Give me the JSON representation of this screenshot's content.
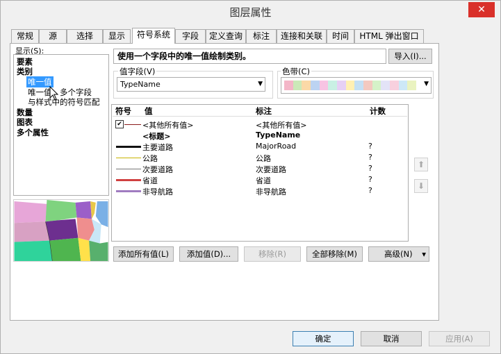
{
  "window": {
    "title": "图层属性",
    "close_glyph": "✕"
  },
  "tabs": [
    "常规",
    "源",
    "选择",
    "显示",
    "符号系统",
    "字段",
    "定义查询",
    "标注",
    "连接和关联",
    "时间",
    "HTML 弹出窗口"
  ],
  "show": {
    "label": "显示(S):",
    "items": [
      "要素",
      "类别",
      "唯一值",
      "唯一值，多个字段",
      "与样式中的符号匹配",
      "数量",
      "图表",
      "多个属性"
    ]
  },
  "description": "使用一个字段中的唯一值绘制类别。",
  "import_label": "导入(I)...",
  "value_field": {
    "label": "值字段(V)",
    "value": "TypeName"
  },
  "color_ramp": {
    "label": "色带(C)",
    "colors": [
      "#f4b6c8",
      "#cbe9b8",
      "#fbd9a7",
      "#bcd3f2",
      "#f7c4e3",
      "#c9f0e4",
      "#e6d0f5",
      "#fff0b3",
      "#c4e0f4",
      "#f3c9c0",
      "#d5f2c8",
      "#e3e3f7",
      "#f8d0de",
      "#cde8f7",
      "#eaf3c0"
    ]
  },
  "table": {
    "headers": {
      "symbol": "符号",
      "value": "值",
      "label": "标注",
      "count": "计数"
    },
    "rows": [
      {
        "value": "<其他所有值>",
        "label": "<其他所有值>",
        "count": "",
        "color": "#8b1a1a",
        "thick": 1,
        "checkbox": true,
        "checked": "✔",
        "bold": false
      },
      {
        "value": "<标题>",
        "label": "TypeName",
        "count": "",
        "color": "",
        "thick": 0,
        "checkbox": false,
        "bold": true
      },
      {
        "value": "主要道路",
        "label": "MajorRoad",
        "count": "?",
        "color": "#111111",
        "thick": 3,
        "checkbox": false,
        "bold": false
      },
      {
        "value": "公路",
        "label": "公路",
        "count": "?",
        "color": "#c8b400",
        "thick": 1,
        "checkbox": false,
        "bold": false
      },
      {
        "value": "次要道路",
        "label": "次要道路",
        "count": "?",
        "color": "#777777",
        "thick": 1,
        "checkbox": false,
        "bold": false
      },
      {
        "value": "省道",
        "label": "省道",
        "count": "?",
        "color": "#d04040",
        "thick": 3,
        "checkbox": false,
        "bold": false
      },
      {
        "value": "非导航路",
        "label": "非导航路",
        "count": "?",
        "color": "#a07cc0",
        "thick": 3,
        "checkbox": false,
        "bold": false
      }
    ]
  },
  "side_buttons": {
    "up": "⬆",
    "down": "⬇"
  },
  "buttons": {
    "add_all": "添加所有值(L)",
    "add": "添加值(D)...",
    "remove": "移除(R)",
    "remove_all": "全部移除(M)",
    "advanced": "高级(N)",
    "advanced_arrow": "▾"
  },
  "dialog_buttons": {
    "ok": "确定",
    "cancel": "取消",
    "apply": "应用(A)"
  }
}
